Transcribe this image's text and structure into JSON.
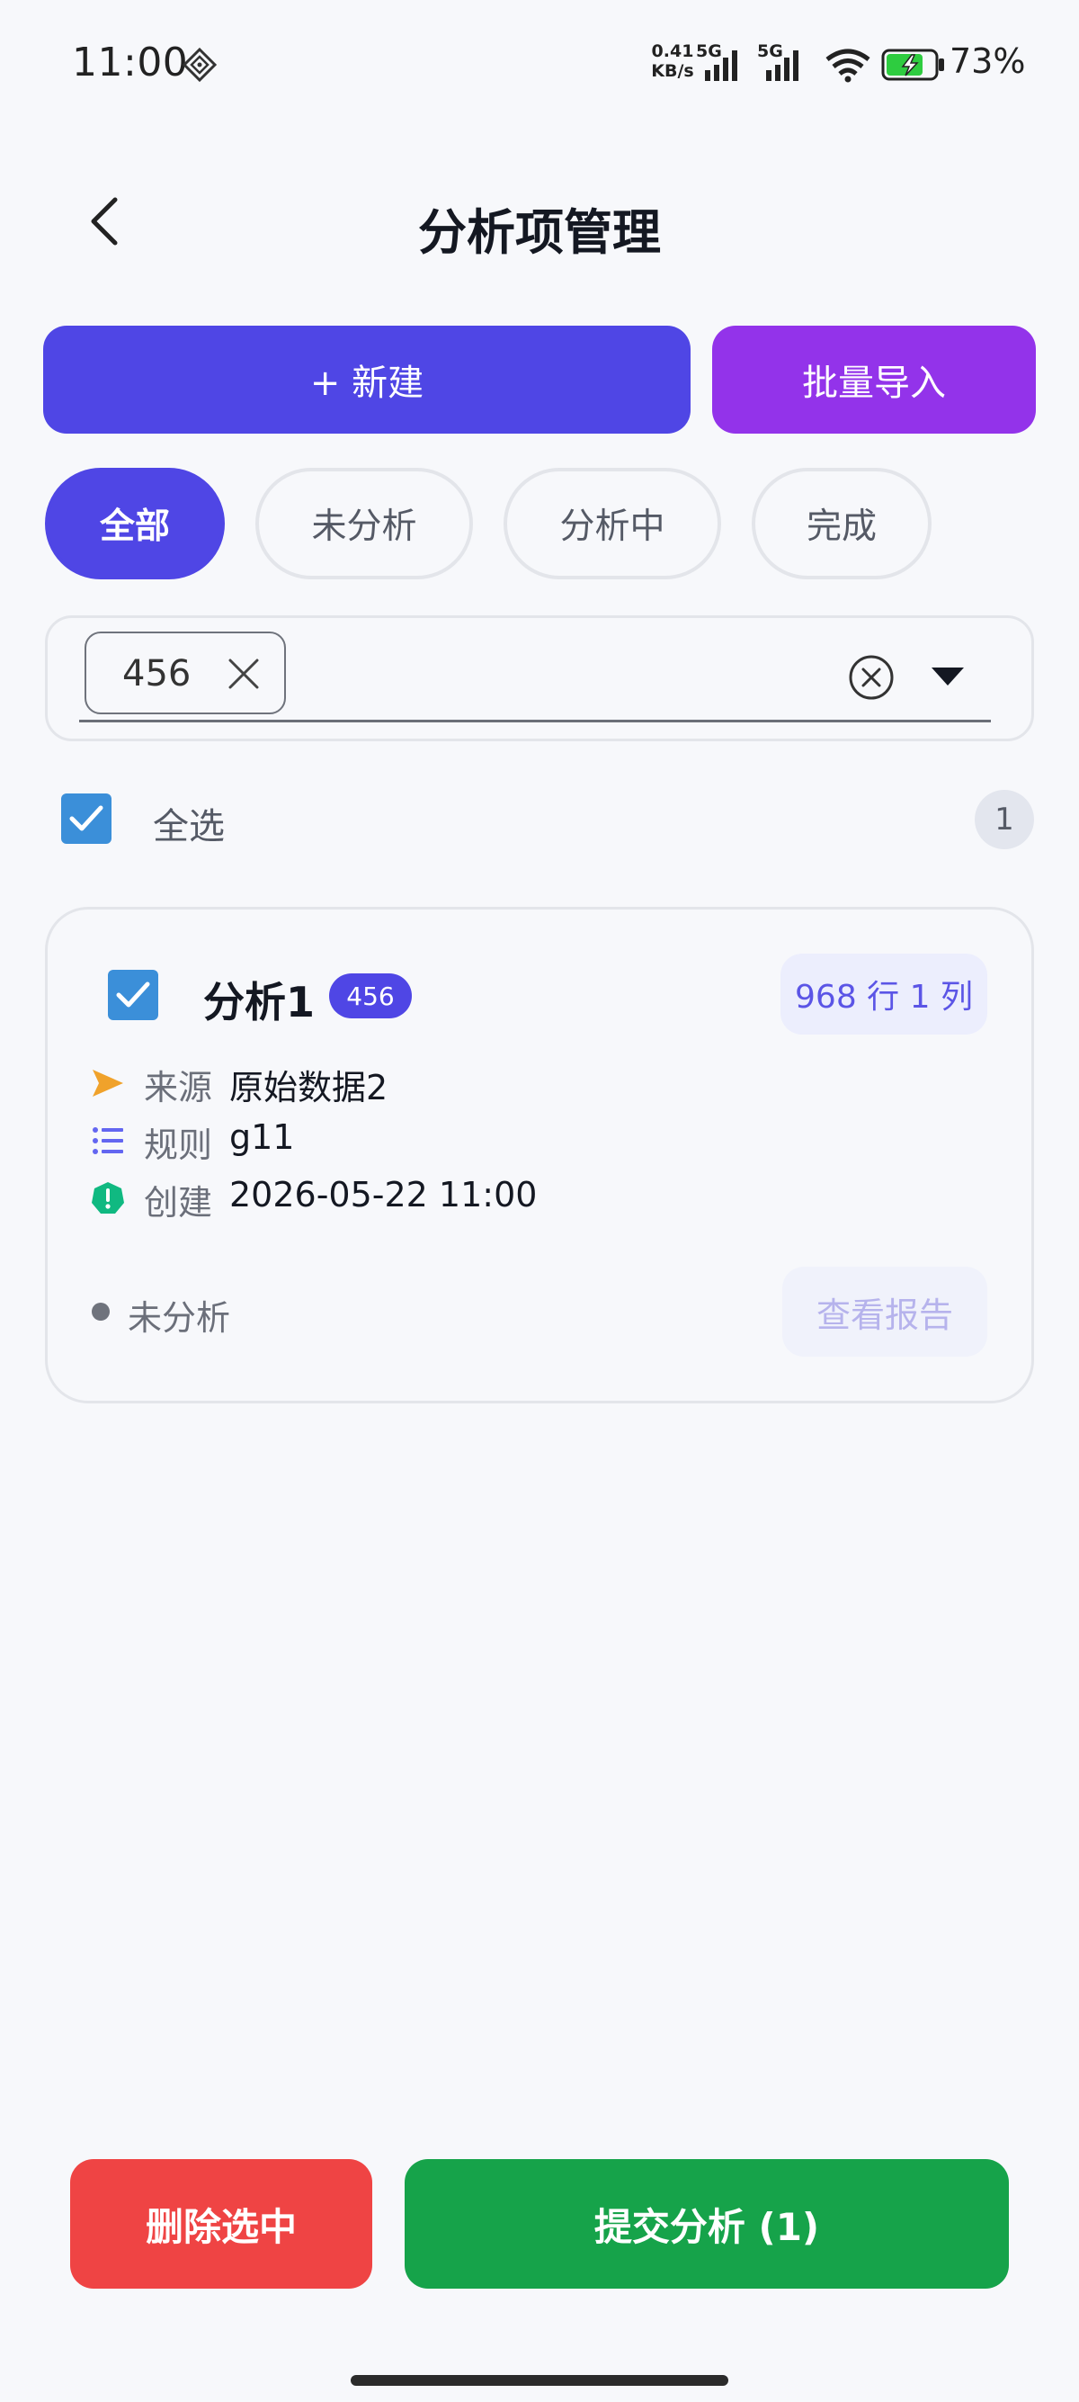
{
  "status_bar": {
    "time": "11:00",
    "net_speed_value": "0.41",
    "net_speed_unit": "KB/s",
    "network_1": "5G",
    "network_2": "5G",
    "battery_percent": "73%"
  },
  "header": {
    "title": "分析项管理"
  },
  "actions": {
    "new_label": "+ 新建",
    "import_label": "批量导入"
  },
  "filters": [
    {
      "label": "全部",
      "active": true
    },
    {
      "label": "未分析",
      "active": false
    },
    {
      "label": "分析中",
      "active": false
    },
    {
      "label": "完成",
      "active": false
    }
  ],
  "tag_select": {
    "selected_tags": [
      "456"
    ]
  },
  "select_all": {
    "label": "全选",
    "checked": true,
    "count": "1"
  },
  "items": [
    {
      "checked": true,
      "title": "分析1",
      "tag": "456",
      "dimensions": "968 行 1 列",
      "source_label": "来源",
      "source_value": "原始数据2",
      "rule_label": "规则",
      "rule_value": "g11",
      "created_label": "创建",
      "created_value": "2026-05-22 11:00",
      "status": "未分析",
      "report_label": "查看报告"
    }
  ],
  "bottom_actions": {
    "delete_label": "删除选中",
    "submit_label": "提交分析 (1)"
  },
  "colors": {
    "primary": "#4f46e5",
    "import": "#9333ea",
    "delete": "#ef4444",
    "submit": "#16a34a",
    "checkbox": "#3b8fd9"
  }
}
